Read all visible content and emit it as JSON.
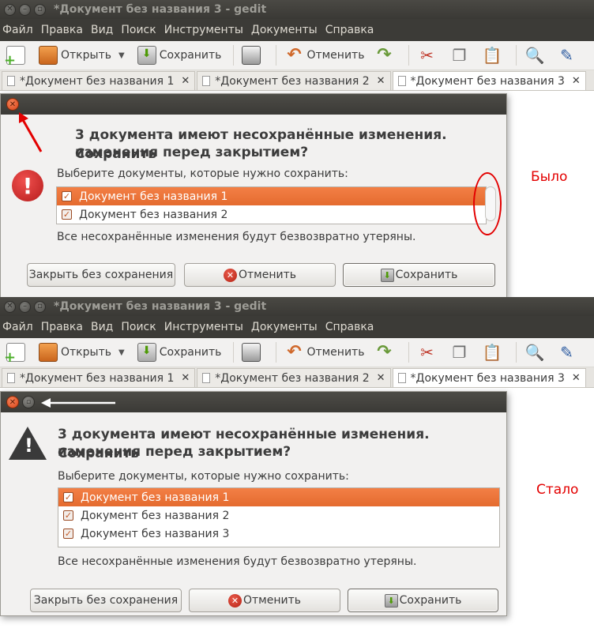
{
  "window_title": "*Документ без названия 3 - gedit",
  "menu": [
    "Файл",
    "Правка",
    "Вид",
    "Поиск",
    "Инструменты",
    "Документы",
    "Справка"
  ],
  "toolbar": {
    "open": "Открыть",
    "save": "Сохранить",
    "undo": "Отменить"
  },
  "tabs": [
    "*Документ без названия 1",
    "*Документ без названия 2",
    "*Документ без названия 3"
  ],
  "dialog": {
    "headline_1": "3 документа имеют несохранённые изменения. Сохранить",
    "headline_2": "изменения перед закрытием?",
    "subtitle": "Выберите документы, которые нужно сохранить:",
    "warning": "Все несохранённые изменения будут безвозвратно утеряны.",
    "close_without_saving": "Закрыть без сохранения",
    "cancel": "Отменить",
    "save": "Сохранить"
  },
  "before": {
    "label": "Было",
    "items": [
      "Документ без названия 1",
      "Документ без названия 2"
    ]
  },
  "after": {
    "label": "Стало",
    "items": [
      "Документ без названия 1",
      "Документ без названия 2",
      "Документ без названия 3"
    ]
  },
  "colors": {
    "annotation": "#e30000",
    "selection": "#f07640",
    "titlebar": "#3c3b37"
  }
}
